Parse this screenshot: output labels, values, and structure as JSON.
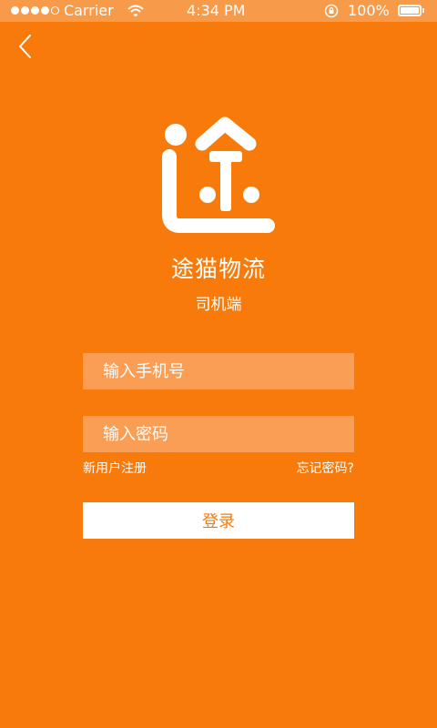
{
  "status_bar": {
    "carrier": "Carrier",
    "time": "4:34 PM",
    "battery": "100%",
    "battery_level": 1.0,
    "signal_filled": 4,
    "signal_total": 5
  },
  "nav": {
    "back_icon": "chevron-left-icon"
  },
  "brand": {
    "logo_icon": "tu-character-logo",
    "name": "途猫物流",
    "subtitle": "司机端"
  },
  "form": {
    "phone_placeholder": "输入手机号",
    "phone_value": "",
    "password_placeholder": "输入密码",
    "password_value": "",
    "register_link": "新用户注册",
    "forgot_link": "忘记密码?",
    "login_button": "登录"
  },
  "colors": {
    "background": "#f77a0a",
    "status_bar": "#f79a4a",
    "input_background": "#f99e54",
    "button_text": "#f77a0a"
  }
}
